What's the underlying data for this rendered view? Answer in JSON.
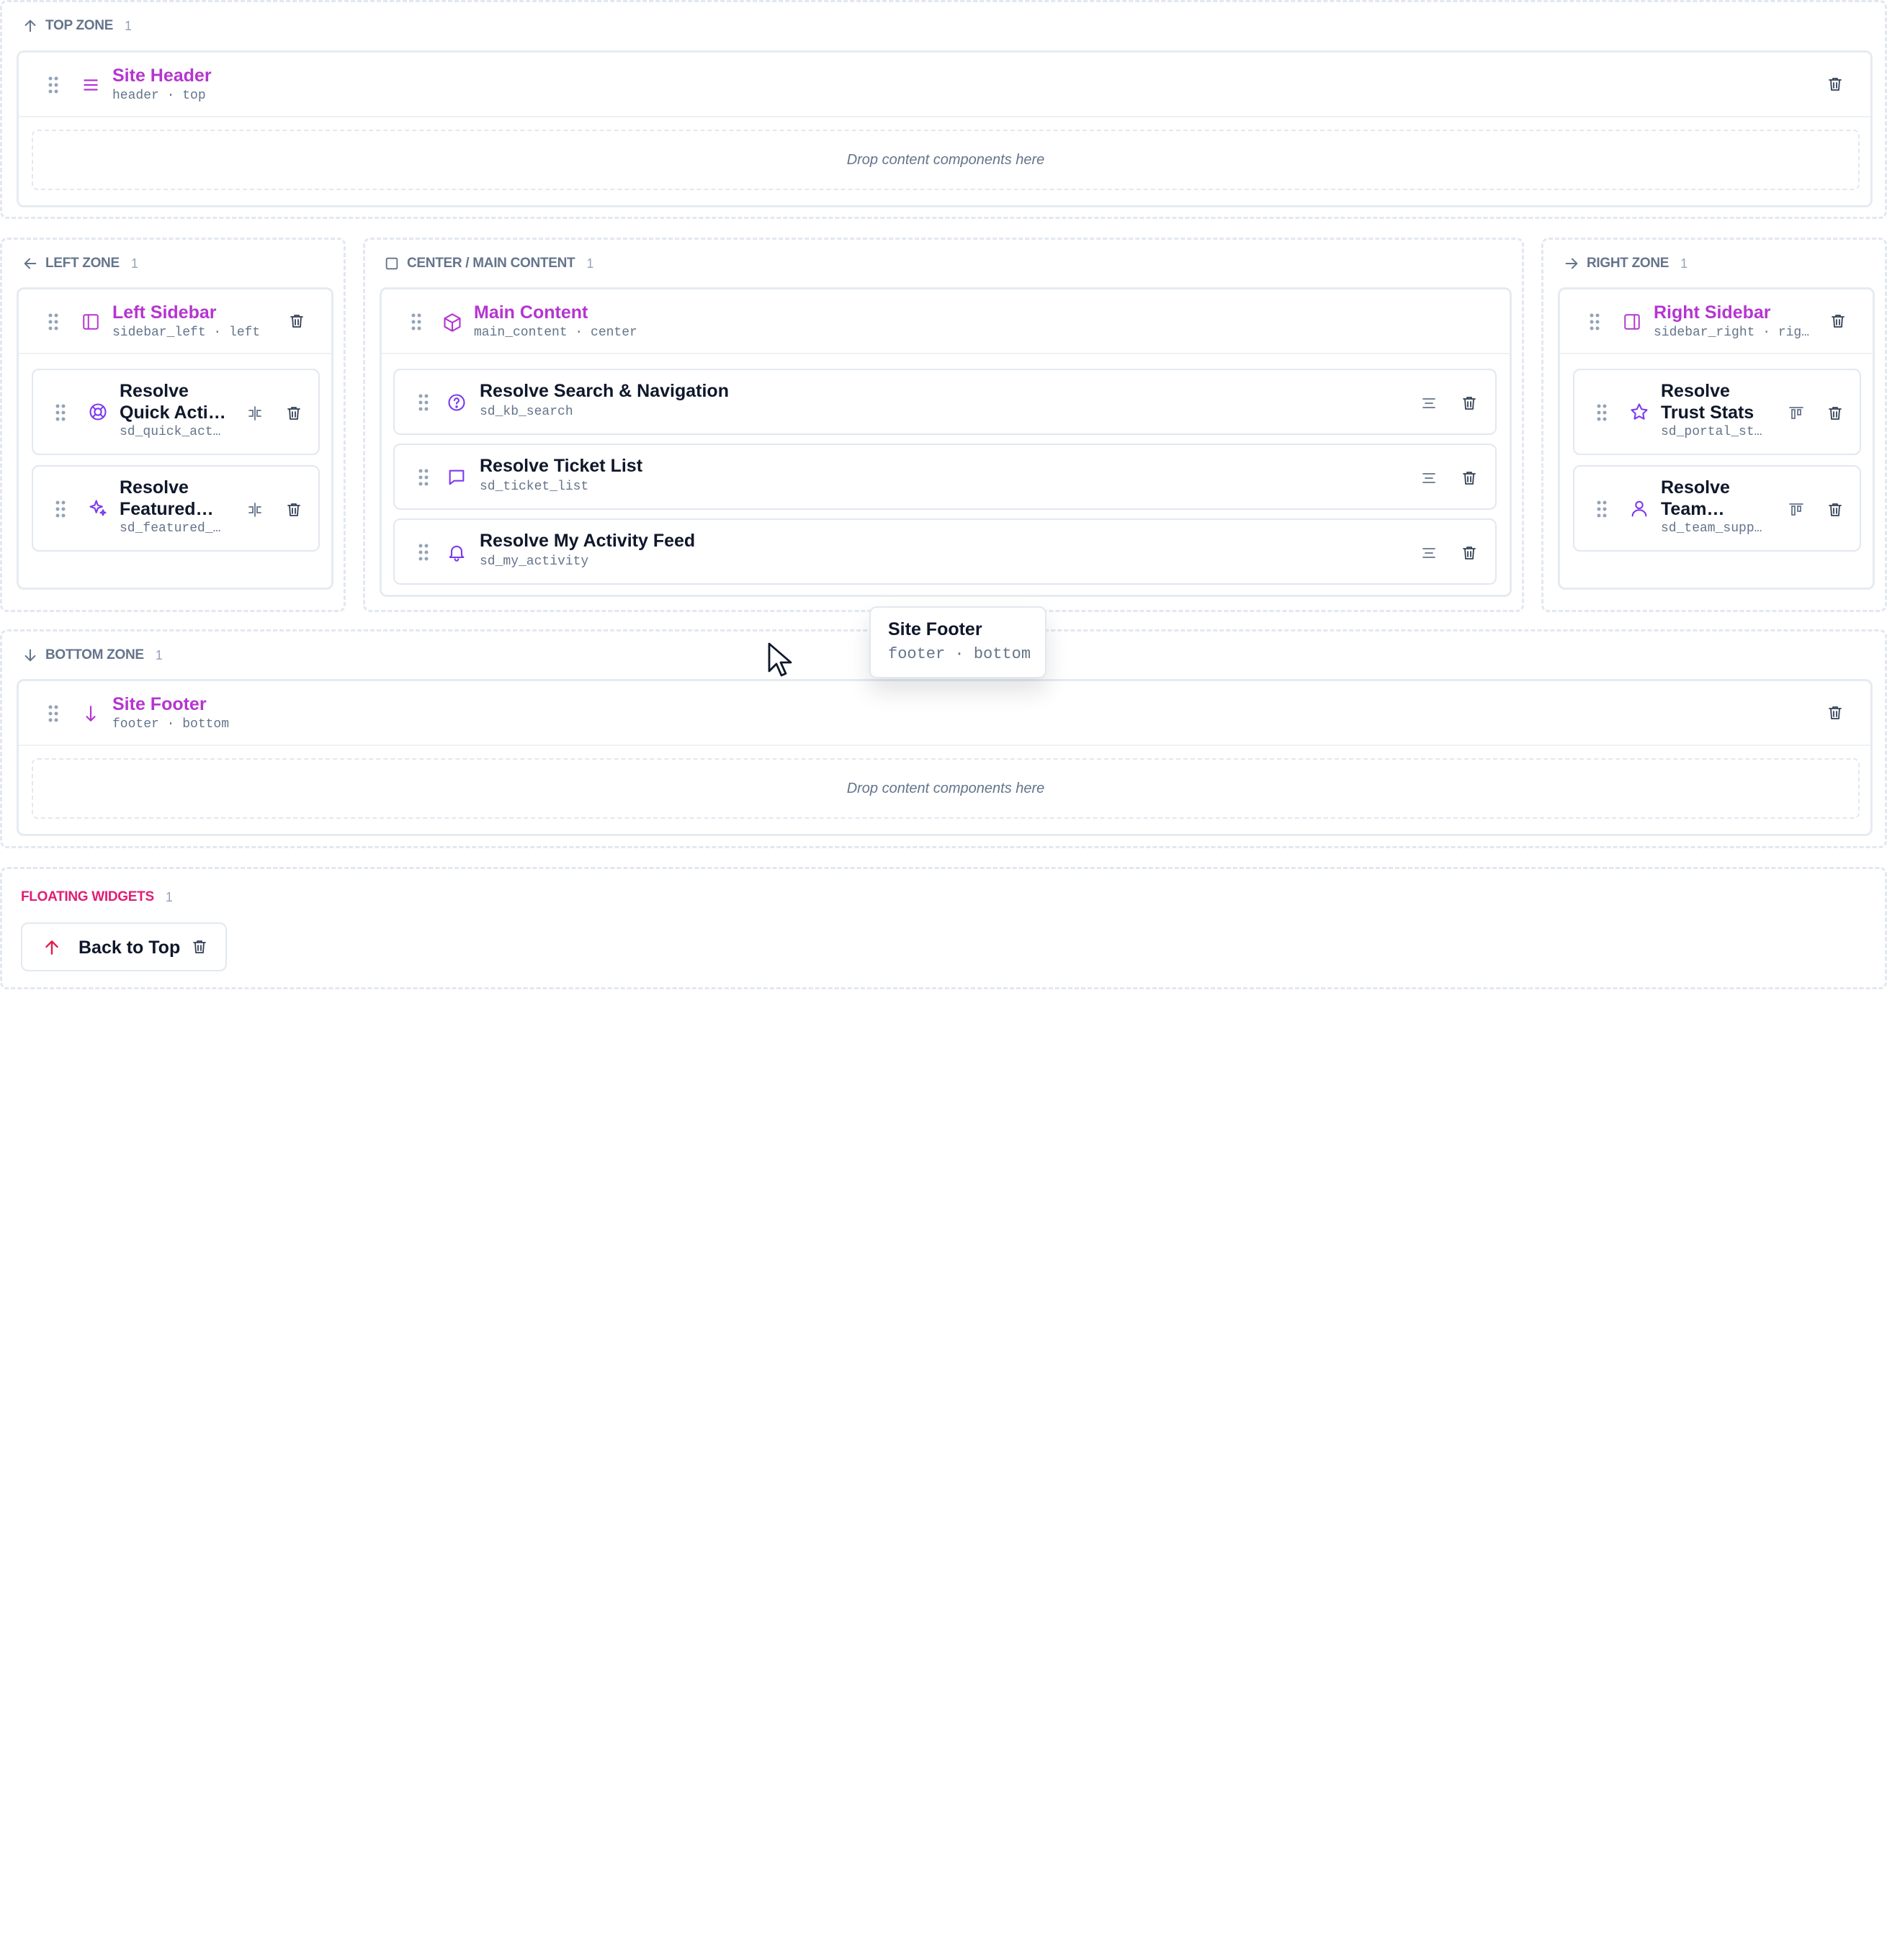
{
  "top_zone": {
    "label": "TOP ZONE",
    "count": "1",
    "layout": {
      "title": "Site Header",
      "subtitle": "header · top"
    },
    "drop_text": "Drop content components here"
  },
  "left_zone": {
    "label": "LEFT ZONE",
    "count": "1",
    "layout": {
      "title": "Left Sidebar",
      "subtitle": "sidebar_left · left"
    },
    "cards": [
      {
        "title": "Resolve Quick Acti…",
        "subtitle": "sd_quick_act…",
        "icon": "lifebuoy-icon"
      },
      {
        "title": "Resolve Featured…",
        "subtitle": "sd_featured_…",
        "icon": "sparkles-icon"
      }
    ]
  },
  "center_zone": {
    "label": "CENTER / MAIN CONTENT",
    "count": "1",
    "layout": {
      "title": "Main Content",
      "subtitle": "main_content · center"
    },
    "cards": [
      {
        "title": "Resolve Search & Navigation",
        "subtitle": "sd_kb_search",
        "icon": "help-circle-icon"
      },
      {
        "title": "Resolve Ticket List",
        "subtitle": "sd_ticket_list",
        "icon": "message-square-icon"
      },
      {
        "title": "Resolve My Activity Feed",
        "subtitle": "sd_my_activity",
        "icon": "bell-icon"
      }
    ]
  },
  "right_zone": {
    "label": "RIGHT ZONE",
    "count": "1",
    "layout": {
      "title": "Right Sidebar",
      "subtitle": "sidebar_right · rig…"
    },
    "cards": [
      {
        "title": "Resolve Trust Stats",
        "subtitle": "sd_portal_st…",
        "icon": "star-icon"
      },
      {
        "title": "Resolve Team…",
        "subtitle": "sd_team_supp…",
        "icon": "user-icon"
      }
    ]
  },
  "bottom_zone": {
    "label": "BOTTOM ZONE",
    "count": "1",
    "layout": {
      "title": "Site Footer",
      "subtitle": "footer · bottom"
    },
    "drop_text": "Drop content components here"
  },
  "floating": {
    "label": "FLOATING WIDGETS",
    "count": "1",
    "widget": {
      "label": "Back to Top",
      "icon": "arrow-up-icon"
    }
  },
  "drag_preview": {
    "title": "Site Footer",
    "subtitle": "footer · bottom"
  },
  "colors": {
    "layout_title": "#b535d0",
    "floating_label": "#e11d74",
    "icon_purple": "#7c3aed",
    "zone_label": "#64748b"
  }
}
